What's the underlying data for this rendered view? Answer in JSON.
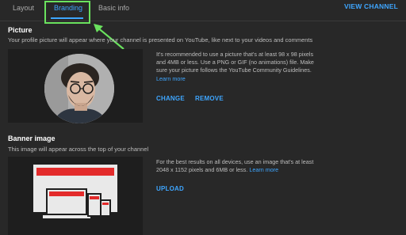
{
  "tabs": [
    {
      "label": "Layout"
    },
    {
      "label": "Branding"
    },
    {
      "label": "Basic info"
    }
  ],
  "header": {
    "view_channel_label": "VIEW CHANNEL"
  },
  "picture": {
    "title": "Picture",
    "subtitle": "Your profile picture will appear where your channel is presented on YouTube, like next to your videos and comments",
    "description": "It's recommended to use a picture that's at least 98 x 98 pixels and 4MB or less. Use a PNG or GIF (no animations) file. Make sure your picture follows the YouTube Community Guidelines.",
    "learn_more": "Learn more",
    "change_label": "CHANGE",
    "remove_label": "REMOVE"
  },
  "banner": {
    "title": "Banner image",
    "subtitle": "This image will appear across the top of your channel",
    "description": "For the best results on all devices, use an image that's at least 2048 x 1152 pixels and 6MB or less.",
    "learn_more": "Learn more",
    "upload_label": "UPLOAD"
  },
  "colors": {
    "background": "#282828",
    "panel": "#1e1e1e",
    "accent": "#3ea6ff",
    "highlight": "#6ae25e",
    "banner_red": "#e32b2b"
  }
}
